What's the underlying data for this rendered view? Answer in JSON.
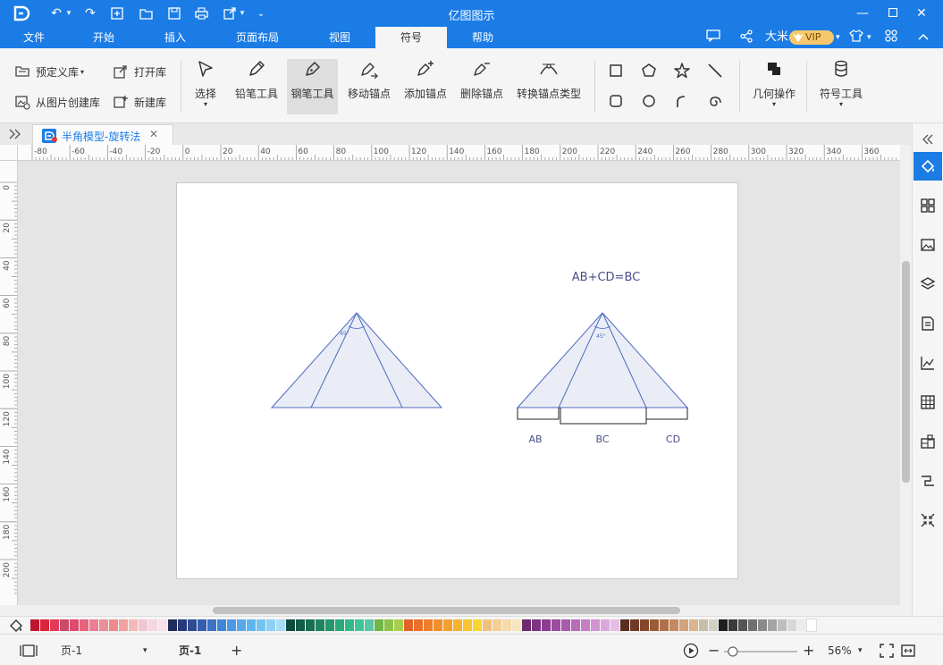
{
  "app": {
    "title": "亿图图示"
  },
  "menu": {
    "tabs": [
      "文件",
      "开始",
      "插入",
      "页面布局",
      "视图",
      "符号",
      "帮助"
    ],
    "active_tab": "符号",
    "user_name": "大米",
    "vip_label": "VIP"
  },
  "toolbar": {
    "predefined_lib": "预定义库",
    "open_lib": "打开库",
    "create_from_image": "从图片创建库",
    "new_lib": "新建库",
    "select": "选择",
    "pencil": "铅笔工具",
    "pen": "钢笔工具",
    "move_anchor": "移动锚点",
    "add_anchor": "添加锚点",
    "delete_anchor": "删除锚点",
    "convert_anchor": "转换锚点类型",
    "geometry_ops": "几何操作",
    "symbol_tools": "符号工具",
    "selected_tool": "钢笔工具"
  },
  "document": {
    "tab_name": "半角模型-旋转法",
    "close_glyph": "✕"
  },
  "ruler": {
    "h_labels": [
      "-80",
      "-60",
      "-40",
      "-20",
      "0",
      "20",
      "40",
      "60",
      "80",
      "100",
      "120",
      "140",
      "160",
      "180",
      "200",
      "220",
      "240",
      "260",
      "280",
      "300",
      "320",
      "340",
      "360"
    ],
    "v_labels": [
      "0",
      "20",
      "40",
      "60",
      "80",
      "100",
      "120",
      "140",
      "160",
      "180",
      "200"
    ]
  },
  "diagram": {
    "equation": "AB+CD=BC",
    "angle_label": "45°",
    "segment_labels": [
      "AB",
      "BC",
      "CD"
    ]
  },
  "palette": {
    "colors": [
      "#c0152f",
      "#d9243c",
      "#e33a57",
      "#c94a6a",
      "#e04a6b",
      "#e8637d",
      "#ec7d94",
      "#ea8f98",
      "#f08a8a",
      "#f2a1a1",
      "#f5b8b8",
      "#f0c7d0",
      "#f3d6e0",
      "#f8e1ea",
      "#1f2d5a",
      "#28397a",
      "#2e4b94",
      "#345fae",
      "#3b73c4",
      "#3f86d8",
      "#4a97e6",
      "#59a7ea",
      "#5fb6ee",
      "#74c4f1",
      "#8ed0f3",
      "#a9dcf6",
      "#0f4a3a",
      "#135c47",
      "#1a6f52",
      "#1f8460",
      "#23986c",
      "#2aa97a",
      "#31b98a",
      "#3ec59a",
      "#59c6a8",
      "#6fb54a",
      "#8ec24a",
      "#abcd4f",
      "#e2622b",
      "#ea6f2a",
      "#ef7f2c",
      "#f28f2d",
      "#f4a02e",
      "#f6b32f",
      "#f8c530",
      "#fad431",
      "#f1c27d",
      "#f3cf95",
      "#f5dbaa",
      "#f7e5c0",
      "#6d2b6d",
      "#7e3380",
      "#8e3c8f",
      "#9c4b9e",
      "#a95aab",
      "#b76cb8",
      "#c47fc5",
      "#d193d2",
      "#dba8dc",
      "#e4bde5",
      "#5a2e1f",
      "#6e3a25",
      "#85482d",
      "#9b5b37",
      "#b07049",
      "#c5885f",
      "#d2a37c",
      "#d9b48f",
      "#c8bea7",
      "#d1d1c4",
      "#1e1e1e",
      "#3a3a3a",
      "#555555",
      "#707070",
      "#8a8a8a",
      "#a4a4a4",
      "#bebebe",
      "#d8d8d8",
      "#ececec",
      "#ffffff"
    ]
  },
  "status": {
    "page_selector": "页-1",
    "page_tab": "页-1",
    "add_page": "+",
    "zoom": "56%",
    "zoom_fraction": 0.12
  }
}
